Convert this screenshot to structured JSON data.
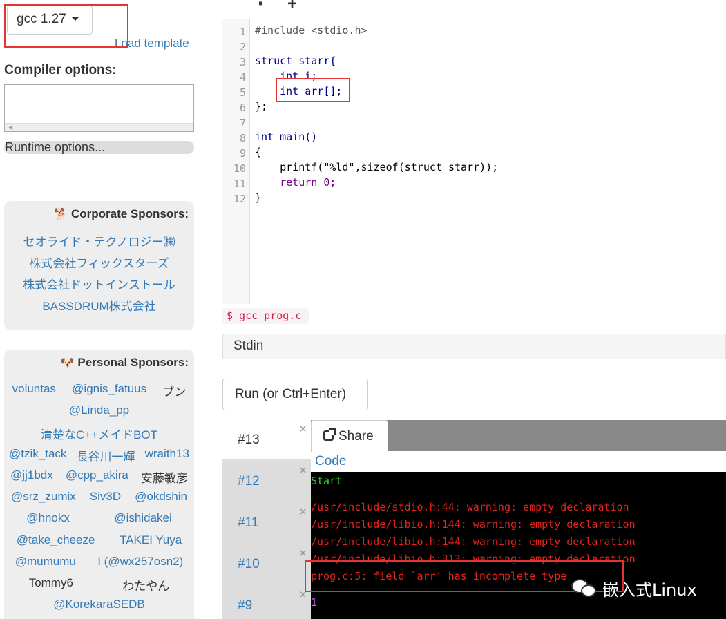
{
  "compiler": {
    "selected": "gcc 1.27",
    "load_template": "Load template"
  },
  "options": {
    "compiler_label": "Compiler options:",
    "compiler_value": "",
    "runtime_label": "Runtime options..."
  },
  "corporate_sponsors": {
    "title": "Corporate Sponsors:",
    "icon": "dog-icon",
    "items": [
      "セオライド・テクノロジー㈱",
      "株式会社フィックスターズ",
      "株式会社ドットインストール",
      "BASSDRUM株式会社"
    ]
  },
  "personal_sponsors": {
    "title": "Personal Sponsors:",
    "icon": "dog-face-icon",
    "rows": [
      [
        "voluntas",
        "@ignis_fatuus",
        "ブン"
      ],
      [
        "@Linda_pp"
      ],
      [
        "清楚なC++メイドBOT"
      ],
      [
        "@tzik_tack",
        "長谷川一輝",
        "wraith13"
      ],
      [
        "@jj1bdx",
        "@cpp_akira",
        "安藤敏彦"
      ],
      [
        "@srz_zumix",
        "Siv3D",
        "@okdshin"
      ],
      [
        "@hnokx",
        "@ishidakei"
      ],
      [
        "@take_cheeze",
        "TAKEI Yuya"
      ],
      [
        "@mumumu",
        "I (@wx257osn2)"
      ],
      [
        "Tommy6",
        "わたやん"
      ],
      [
        "@KorekaraSEDB"
      ]
    ]
  },
  "editor": {
    "line_numbers": [
      "1",
      "2",
      "3",
      "4",
      "5",
      "6",
      "7",
      "8",
      "9",
      "10",
      "11",
      "12"
    ],
    "code": [
      "#include <stdio.h>",
      "",
      "struct starr{",
      "    int i;",
      "    int arr[];",
      "};",
      "",
      "int main()",
      "{",
      "    printf(\"%ld\",sizeof(struct starr));",
      "    return 0;",
      "}"
    ]
  },
  "command": "$ gcc prog.c",
  "stdin_label": "Stdin",
  "run_label": "Run (or Ctrl+Enter)",
  "tabs": [
    "#13",
    "#12",
    "#11",
    "#10",
    "#9"
  ],
  "tab_close": "×",
  "share_label": "Share",
  "code_link": "Code",
  "console": {
    "start": "Start",
    "lines": [
      "/usr/include/stdio.h:44: warning: empty declaration",
      "/usr/include/libio.h:144: warning: empty declaration",
      "/usr/include/libio.h:144: warning: empty declaration",
      "/usr/include/libio.h:313: warning: empty declaration",
      "prog.c:5: field `arr' has incomplete type"
    ],
    "exit": "1"
  },
  "watermark": "嵌入式Linux",
  "colors": {
    "link": "#337ab7",
    "console_bg": "#000000",
    "console_error": "#e4251e",
    "console_start": "#34d12e",
    "highlight_box": "#e53333"
  }
}
